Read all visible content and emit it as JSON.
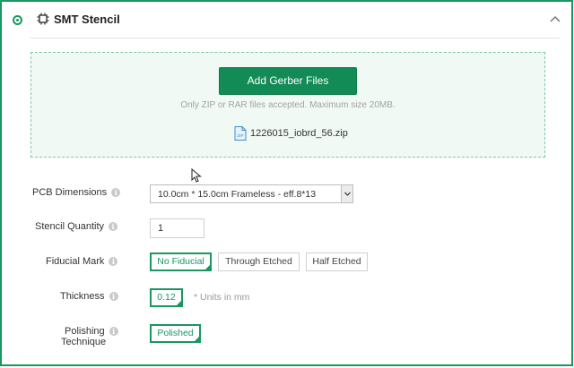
{
  "header": {
    "title": "SMT Stencil",
    "selected": true,
    "accent_color": "#1a9660"
  },
  "upload": {
    "button_label": "Add Gerber Files",
    "hint": "Only ZIP or RAR files accepted. Maximum size 20MB.",
    "file_icon": "zip-file-icon",
    "file_icon_text": "ZIP",
    "file_name": "1226015_iobrd_56.zip"
  },
  "form": {
    "pcb_dimensions": {
      "label": "PCB Dimensions",
      "value": "10.0cm * 15.0cm Frameless - eff.8*13"
    },
    "stencil_quantity": {
      "label": "Stencil Quantity",
      "value": "1"
    },
    "fiducial_mark": {
      "label": "Fiducial Mark",
      "options": [
        "No Fiducial",
        "Through Etched",
        "Half Etched"
      ],
      "selected": "No Fiducial"
    },
    "thickness": {
      "label": "Thickness",
      "value": "0.12",
      "note": "* Units in mm"
    },
    "polishing": {
      "label_line1": "Polishing",
      "label_line2": "Technique",
      "value": "Polished"
    },
    "info_glyph": "i"
  }
}
